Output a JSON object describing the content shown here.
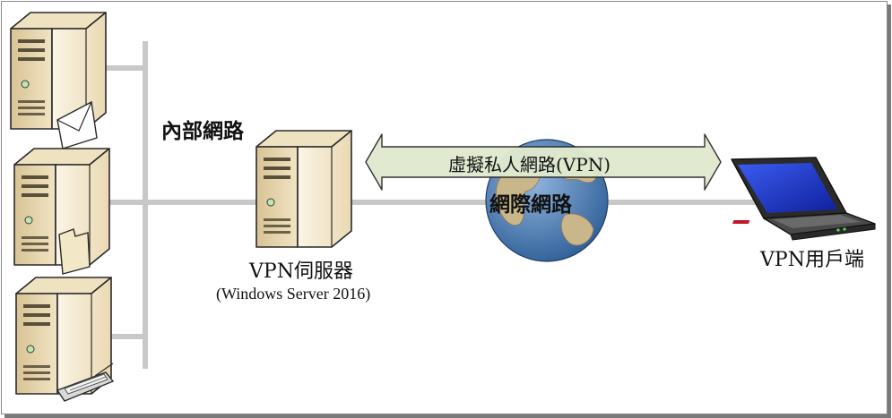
{
  "labels": {
    "internal_network": "內部網路",
    "vpn_server": "VPN伺服器",
    "vpn_server_os": "(Windows Server 2016)",
    "vpn_client": "VPN用戶端",
    "vpn_tunnel": "虛擬私人網路(VPN)",
    "internet": "網際網路"
  },
  "icons": {
    "mail_server": "mail-server-icon",
    "file_server": "file-server-icon",
    "print_server": "print-server-icon",
    "vpn_server": "server-icon",
    "laptop": "laptop-icon",
    "globe": "globe-icon",
    "tunnel": "double-arrow-icon"
  },
  "colors": {
    "server_body": "#f6edd8",
    "server_shadow": "#d9c69b",
    "network_line": "#c8c8c8",
    "arrow_fill": "#e0ead0",
    "globe_ocean": "#5585b8",
    "globe_land": "#c8b48a",
    "laptop_screen": "#1a36c8"
  }
}
